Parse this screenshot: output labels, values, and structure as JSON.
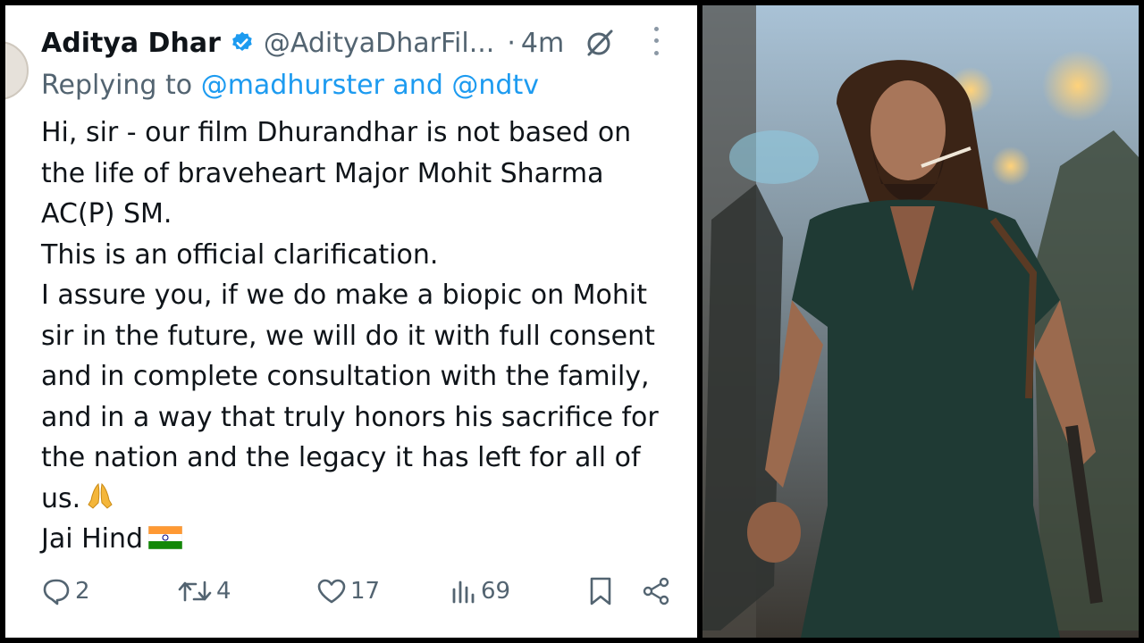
{
  "tweet": {
    "author_name": "Aditya Dhar",
    "handle": "@AdityaDharFil...",
    "separator": "·",
    "time": "4m",
    "reply_prefix": "Replying to",
    "reply_mentions": "@madhurster and @ndtv",
    "body_lines": [
      "Hi, sir - our film Dhurandhar is not based on",
      "the life of braveheart Major Mohit Sharma",
      "AC(P) SM.",
      "This is an official clarification.",
      "I assure you, if we do make a biopic on Mohit",
      "sir in the future, we will do it with full consent",
      "and in complete consultation with the family,",
      "and in a way that truly honors his sacrifice for",
      "the nation and the legacy it has left for all of",
      "us.",
      "Jai Hind"
    ],
    "stats": {
      "replies": "2",
      "reposts": "4",
      "likes": "17",
      "views": "69"
    }
  },
  "colors": {
    "text": "#0f1419",
    "muted": "#536471",
    "link": "#1d9bf0",
    "verified": "#1d9bf0"
  },
  "icons": [
    "verified-badge-icon",
    "grok-icon",
    "more-icon",
    "reply-icon",
    "repost-icon",
    "like-icon",
    "views-icon",
    "bookmark-icon",
    "share-icon",
    "india-flag-icon",
    "folded-hands-icon"
  ]
}
